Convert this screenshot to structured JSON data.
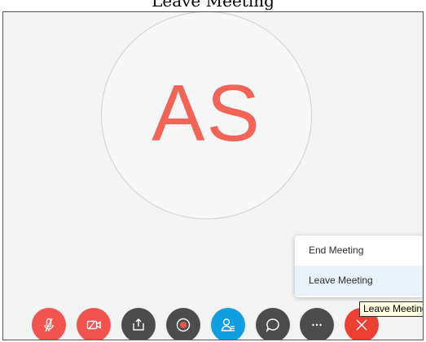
{
  "caption": {
    "text": "Leave Meeting"
  },
  "participant": {
    "initials": "AS"
  },
  "leave_menu": {
    "items": [
      {
        "label": "End Meeting"
      },
      {
        "label": "Leave Meeting"
      }
    ]
  },
  "tooltip": {
    "text": "Leave Meeting"
  },
  "toolbar": {
    "buttons": [
      {
        "icon": "mic-muted-icon",
        "color": "#f1534f"
      },
      {
        "icon": "video-off-icon",
        "color": "#f1534f"
      },
      {
        "icon": "share-icon",
        "color": "#4c4c4c"
      },
      {
        "icon": "record-icon",
        "color": "#4c4c4c"
      },
      {
        "icon": "participants-icon",
        "color": "#0f9fe0"
      },
      {
        "icon": "chat-icon",
        "color": "#4c4c4c"
      },
      {
        "icon": "more-icon",
        "color": "#4c4c4c"
      },
      {
        "icon": "close-icon",
        "color": "#ee3f34"
      }
    ]
  },
  "colors": {
    "accent_red": "#f1534f",
    "avatar_text": "#f26358",
    "participants_blue": "#0f9fe0"
  }
}
